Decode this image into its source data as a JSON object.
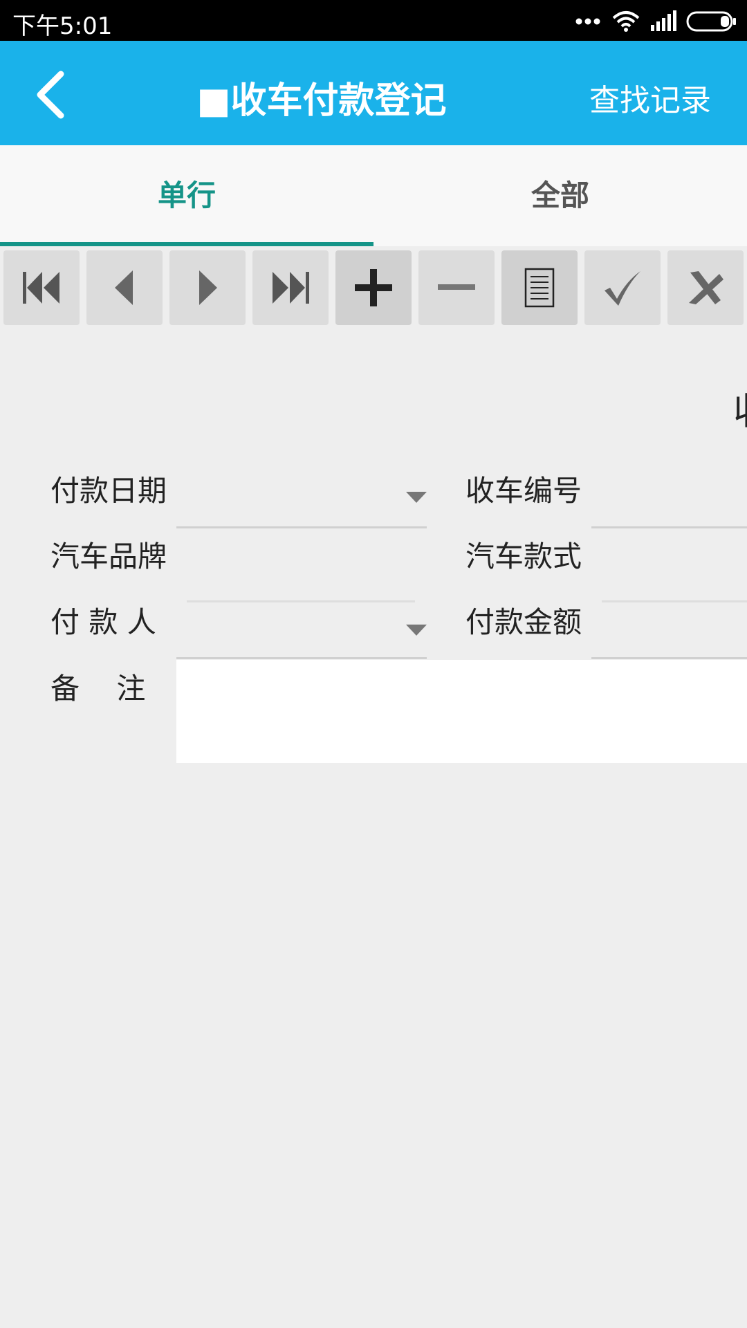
{
  "status_bar": {
    "time": "下午5:01",
    "icons": [
      "more-dots-icon",
      "wifi-icon",
      "signal-icon",
      "battery-icon"
    ]
  },
  "app_bar": {
    "title": "■收车付款登记",
    "find_records": "查找记录",
    "background_color": "#1ab2ea"
  },
  "tabs": [
    {
      "label": "单行",
      "selected": true
    },
    {
      "label": "全部",
      "selected": false
    }
  ],
  "accent_color": "#159488",
  "toolbar": {
    "buttons": [
      "first-record-icon",
      "previous-icon",
      "next-icon",
      "last-record-icon",
      "add-icon",
      "remove-icon",
      "list-icon",
      "confirm-icon",
      "cancel-icon"
    ]
  },
  "form": {
    "heading": "收",
    "fields": {
      "payment_date": {
        "label": "付款日期",
        "value": ""
      },
      "car_receipt_number": {
        "label": "收车编号",
        "value": ""
      },
      "car_brand": {
        "label": "汽车品牌",
        "value": ""
      },
      "car_model": {
        "label": "汽车款式",
        "value": ""
      },
      "payer": {
        "label": "付 款 人",
        "value": ""
      },
      "payment_amount": {
        "label": "付款金额",
        "value": ""
      },
      "remarks": {
        "label": "备    注",
        "value": ""
      }
    }
  }
}
